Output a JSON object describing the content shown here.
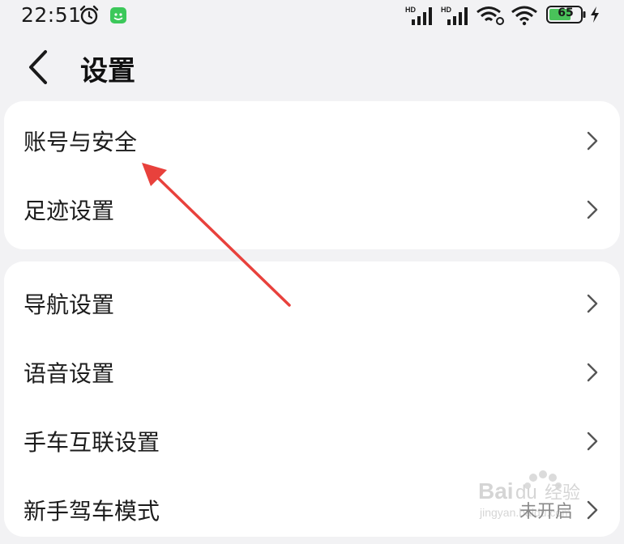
{
  "status_bar": {
    "time": "22:51",
    "battery": "65",
    "signal1_label": "HD",
    "signal2_label": "HD",
    "icons": [
      "alarm-icon",
      "app-notification-icon",
      "signal-icon",
      "signal-icon",
      "wifi-link-icon",
      "wifi-icon",
      "battery-icon",
      "charging-icon"
    ]
  },
  "header": {
    "title": "设置",
    "back_icon": "chevron-left-icon"
  },
  "groups": [
    {
      "items": [
        {
          "label": "账号与安全"
        },
        {
          "label": "足迹设置"
        }
      ]
    },
    {
      "items": [
        {
          "label": "导航设置"
        },
        {
          "label": "语音设置"
        },
        {
          "label": "手车互联设置"
        },
        {
          "label": "新手驾车模式",
          "value": "未开启"
        }
      ]
    }
  ],
  "annotation": {
    "color": "#e8413c",
    "type": "arrow"
  },
  "colors": {
    "background": "#f2f2f4",
    "card": "#ffffff",
    "app_icon": "#3cc85a",
    "battery_fill": "#49c25a"
  }
}
